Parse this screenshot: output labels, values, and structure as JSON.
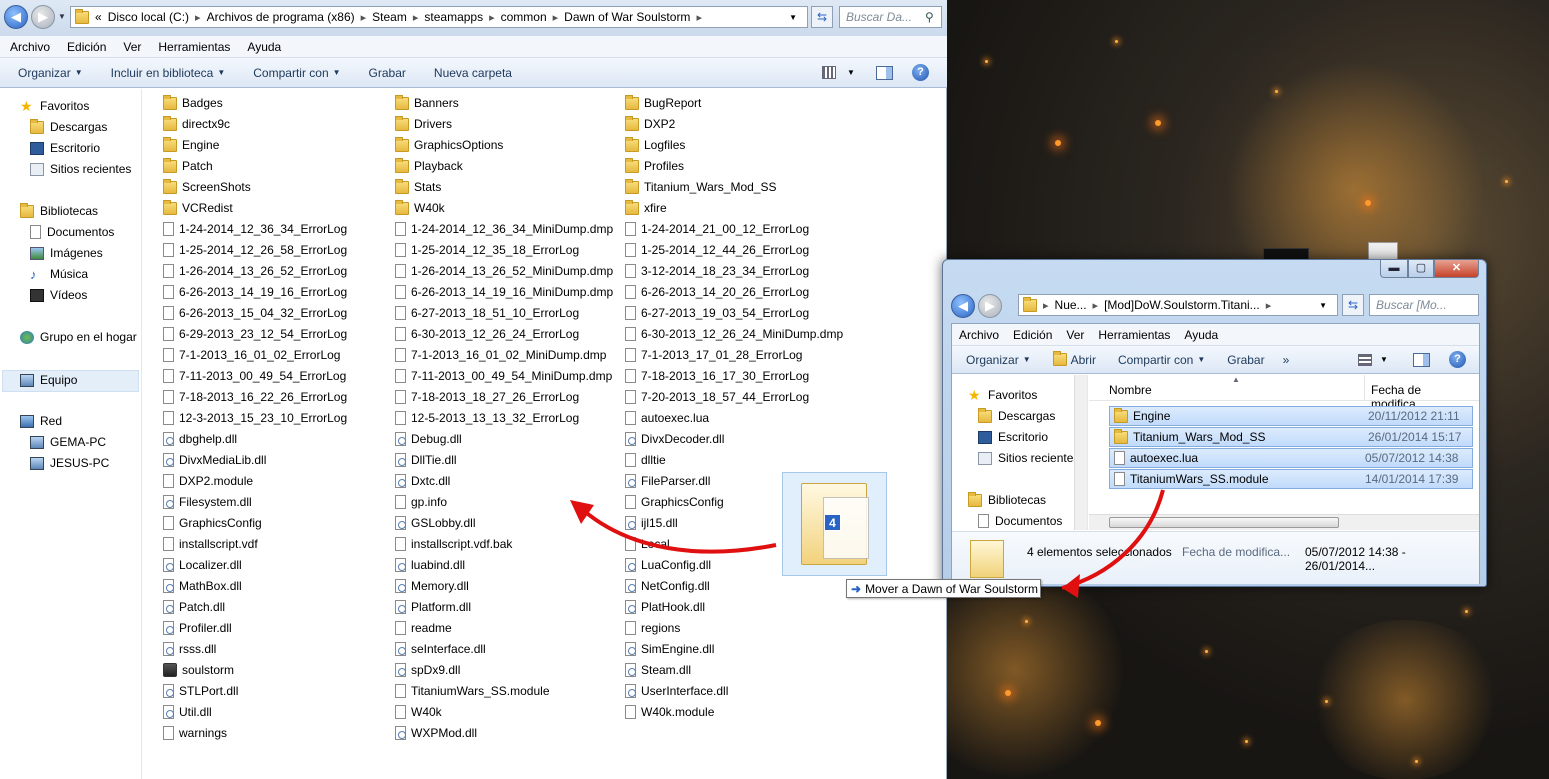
{
  "explorer": {
    "back_icon": "back-arrow-icon",
    "forward_icon": "forward-arrow-icon",
    "path": [
      "«",
      "Disco local (C:)",
      "Archivos de programa (x86)",
      "Steam",
      "steamapps",
      "common",
      "Dawn of War Soulstorm"
    ],
    "search_placeholder": "Buscar Da...",
    "menu": [
      "Archivo",
      "Edición",
      "Ver",
      "Herramientas",
      "Ayuda"
    ],
    "toolbar": [
      "Organizar",
      "Incluir en biblioteca",
      "Compartir con",
      "Grabar",
      "Nueva carpeta"
    ],
    "nav": {
      "favorites": "Favoritos",
      "downloads": "Descargas",
      "desktop": "Escritorio",
      "recent": "Sitios recientes",
      "libraries": "Bibliotecas",
      "documents": "Documentos",
      "images": "Imágenes",
      "music": "Música",
      "videos": "Vídeos",
      "homegroup": "Grupo en el hogar",
      "computer": "Equipo",
      "network": "Red",
      "pc1": "GEMA-PC",
      "pc2": "JESUS-PC"
    },
    "col1": [
      "Badges",
      "directx9c",
      "Engine",
      "Patch",
      "ScreenShots",
      "VCRedist",
      "1-24-2014_12_36_34_ErrorLog",
      "1-25-2014_12_26_58_ErrorLog",
      "1-26-2014_13_26_52_ErrorLog",
      "6-26-2013_14_19_16_ErrorLog",
      "6-26-2013_15_04_32_ErrorLog",
      "6-29-2013_23_12_54_ErrorLog",
      "7-1-2013_16_01_02_ErrorLog",
      "7-11-2013_00_49_54_ErrorLog",
      "7-18-2013_16_22_26_ErrorLog",
      "12-3-2013_15_23_10_ErrorLog",
      "dbghelp.dll",
      "DivxMediaLib.dll",
      "DXP2.module",
      "Filesystem.dll",
      "GraphicsConfig",
      "installscript.vdf",
      "Localizer.dll",
      "MathBox.dll",
      "Patch.dll",
      "Profiler.dll",
      "rsss.dll",
      "soulstorm",
      "STLPort.dll",
      "Util.dll",
      "warnings"
    ],
    "col2": [
      "Banners",
      "Drivers",
      "GraphicsOptions",
      "Playback",
      "Stats",
      "W40k",
      "1-24-2014_12_36_34_MiniDump.dmp",
      "1-25-2014_12_35_18_ErrorLog",
      "1-26-2014_13_26_52_MiniDump.dmp",
      "6-26-2013_14_19_16_MiniDump.dmp",
      "6-27-2013_18_51_10_ErrorLog",
      "6-30-2013_12_26_24_ErrorLog",
      "7-1-2013_16_01_02_MiniDump.dmp",
      "7-11-2013_00_49_54_MiniDump.dmp",
      "7-18-2013_18_27_26_ErrorLog",
      "12-5-2013_13_13_32_ErrorLog",
      "Debug.dll",
      "DllTie.dll",
      "Dxtc.dll",
      "gp.info",
      "GSLobby.dll",
      "installscript.vdf.bak",
      "luabind.dll",
      "Memory.dll",
      "Platform.dll",
      "readme",
      "seInterface.dll",
      "spDx9.dll",
      "TitaniumWars_SS.module",
      "W40k",
      "WXPMod.dll"
    ],
    "col3": [
      "BugReport",
      "DXP2",
      "Logfiles",
      "Profiles",
      "Titanium_Wars_Mod_SS",
      "xfire",
      "1-24-2014_21_00_12_ErrorLog",
      "1-25-2014_12_44_26_ErrorLog",
      "3-12-2014_18_23_34_ErrorLog",
      "6-26-2013_14_20_26_ErrorLog",
      "6-27-2013_19_03_54_ErrorLog",
      "6-30-2013_12_26_24_MiniDump.dmp",
      "7-1-2013_17_01_28_ErrorLog",
      "7-18-2013_16_17_30_ErrorLog",
      "7-20-2013_18_57_44_ErrorLog",
      "autoexec.lua",
      "DivxDecoder.dll",
      "dlltie",
      "FileParser.dll",
      "GraphicsConfig",
      "ijl15.dll",
      "Local",
      "LuaConfig.dll",
      "NetConfig.dll",
      "PlatHook.dll",
      "regions",
      "SimEngine.dll",
      "Steam.dll",
      "UserInterface.dll",
      "W40k.module"
    ]
  },
  "mod_window": {
    "path": [
      "Nue...",
      "[Mod]DoW.Soulstorm.Titani..."
    ],
    "search_placeholder": "Buscar [Mo...",
    "menu": [
      "Archivo",
      "Edición",
      "Ver",
      "Herramientas",
      "Ayuda"
    ],
    "toolbar": [
      "Organizar",
      "Abrir",
      "Compartir con",
      "Grabar",
      "»"
    ],
    "nav": [
      "Favoritos",
      "Descargas",
      "Escritorio",
      "Sitios recientes",
      "Bibliotecas",
      "Documentos"
    ],
    "col_name": "Nombre",
    "col_date": "Fecha de modifica...",
    "files": [
      {
        "name": "Engine",
        "date": "20/11/2012 21:11"
      },
      {
        "name": "Titanium_Wars_Mod_SS",
        "date": "26/01/2014 15:17"
      },
      {
        "name": "autoexec.lua",
        "date": "05/07/2012 14:38"
      },
      {
        "name": "TitaniumWars_SS.module",
        "date": "14/01/2014 17:39"
      }
    ],
    "status": "4 elementos seleccionados",
    "status_date_label": "Fecha de modifica...",
    "status_date": "05/07/2012 14:38 - 26/01/2014..."
  },
  "drag": {
    "count": "4",
    "tooltip": "Mover a Dawn of War Soulstorm"
  },
  "colors": {
    "arrow": "#e01010",
    "selection": "#c1dbfc"
  }
}
